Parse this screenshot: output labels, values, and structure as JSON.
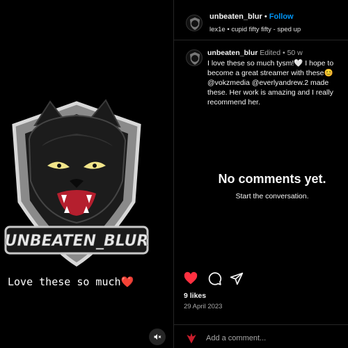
{
  "media": {
    "logo_text": "UNBEATEN_BLUR",
    "caption_text": "Love these so much",
    "caption_emoji": "❤️",
    "mute_icon": "speaker-muted-icon"
  },
  "header": {
    "username": "unbeaten_blur",
    "separator": "•",
    "follow_label": "Follow",
    "audio_artist": "lex1e",
    "audio_separator": "•",
    "audio_title": "cupid fifty fifty - sped up"
  },
  "comment": {
    "username": "unbeaten_blur",
    "edited": "Edited",
    "separator": "•",
    "time": "50 w",
    "lines": [
      "I love these so much tysm!🤍 I hope to",
      "become a great streamer with these😊",
      "@vokzmedia @everlyandrew.2 made",
      "these. Her work is amazing and I really",
      "recommend her."
    ]
  },
  "empty_state": {
    "title": "No comments yet.",
    "subtitle": "Start the conversation."
  },
  "actions": {
    "like_icon": "heart-filled-icon",
    "comment_icon": "comment-icon",
    "share_icon": "send-icon",
    "like_color": "#ff3040"
  },
  "likes": "9 likes",
  "date": "29 April 2023",
  "comment_bar": {
    "emoji_icon": "emoji-icon",
    "placeholder": "Add a comment..."
  }
}
